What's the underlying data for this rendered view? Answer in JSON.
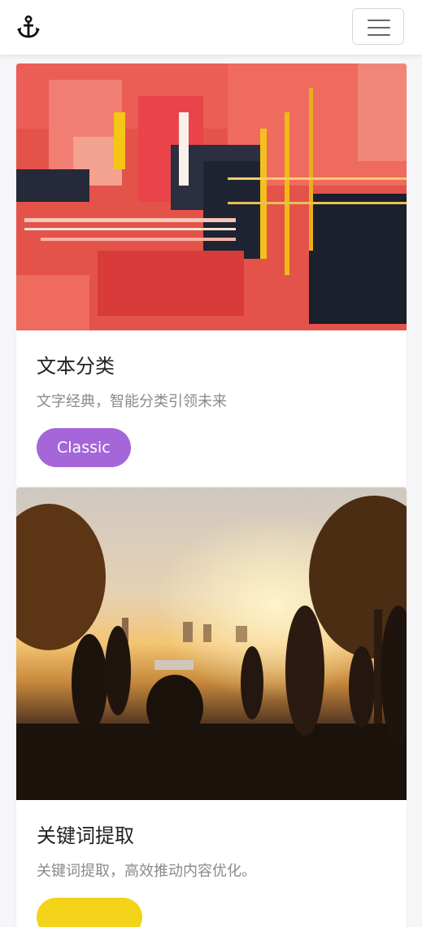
{
  "nav": {
    "brand_icon": "anchor-icon",
    "menu_icon": "hamburger-menu-icon"
  },
  "cards": [
    {
      "title": "文本分类",
      "description": "文字经典，智能分类引领未来",
      "badge": "Classic",
      "badge_color": "#a466d8"
    },
    {
      "title": "关键词提取",
      "description": "关键词提取，高效推动内容优化。",
      "badge": "",
      "badge_color": "#f3d21a"
    }
  ]
}
